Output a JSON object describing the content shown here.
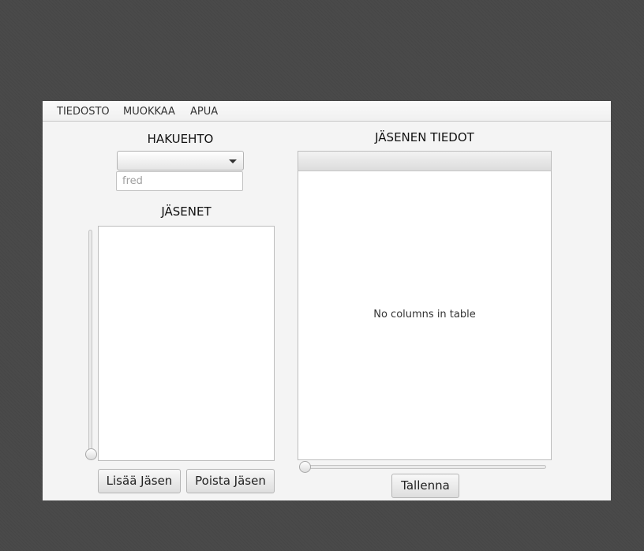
{
  "menubar": {
    "items": [
      {
        "label": "TIEDOSTO"
      },
      {
        "label": "MUOKKAA"
      },
      {
        "label": "APUA"
      }
    ]
  },
  "search": {
    "heading": "HAKUEHTO",
    "combo_value": "",
    "field_value": "",
    "field_placeholder": "fred"
  },
  "members": {
    "heading": "JÄSENET",
    "items": [],
    "add_label": "Lisää Jäsen",
    "remove_label": "Poista Jäsen",
    "slider_value": 0
  },
  "details": {
    "heading": "JÄSENEN TIEDOT",
    "columns": [],
    "empty_text": "No columns in table",
    "save_label": "Tallenna",
    "slider_value": 0
  }
}
